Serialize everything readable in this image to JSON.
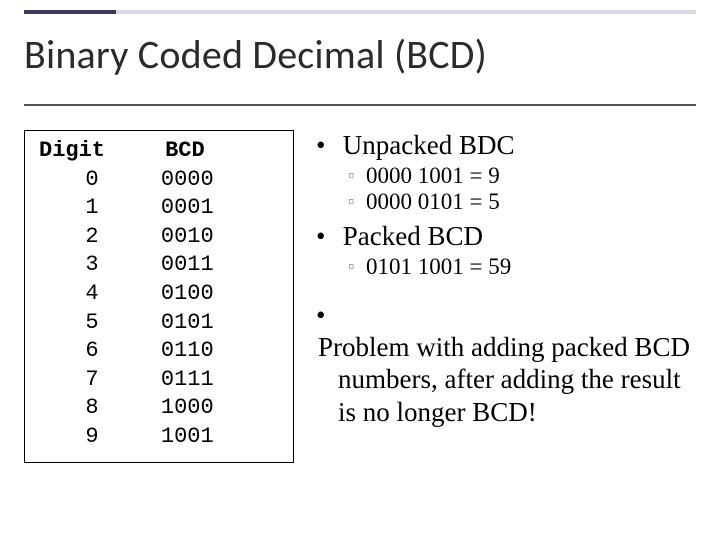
{
  "title": "Binary Coded Decimal (BCD)",
  "table": {
    "header_digit": "Digit",
    "header_bcd": "BCD",
    "rows": [
      {
        "digit": "0",
        "bcd": "0000"
      },
      {
        "digit": "1",
        "bcd": "0001"
      },
      {
        "digit": "2",
        "bcd": "0010"
      },
      {
        "digit": "3",
        "bcd": "0011"
      },
      {
        "digit": "4",
        "bcd": "0100"
      },
      {
        "digit": "5",
        "bcd": "0101"
      },
      {
        "digit": "6",
        "bcd": "0110"
      },
      {
        "digit": "7",
        "bcd": "0111"
      },
      {
        "digit": "8",
        "bcd": "1000"
      },
      {
        "digit": "9",
        "bcd": "1001"
      }
    ]
  },
  "bullets": {
    "unpacked_title": "Unpacked BDC",
    "unpacked_ex1": "0000 1001 = 9",
    "unpacked_ex2": "0000 0101 = 5",
    "packed_title": "Packed BCD",
    "packed_ex1": "0101 1001 = 59",
    "problem": "Problem with adding packed BCD numbers, after adding the result is no longer BCD!"
  }
}
